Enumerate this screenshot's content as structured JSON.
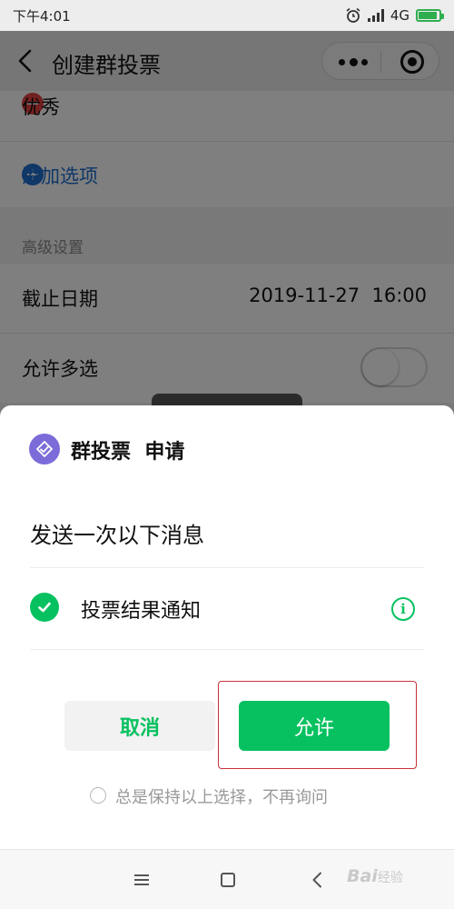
{
  "status_bar": {
    "time": "下午4:01",
    "network": "4G"
  },
  "nav": {
    "title": "创建群投票"
  },
  "form": {
    "option_label": "优秀",
    "add_option_label": "添加选项",
    "section_header": "高级设置",
    "deadline_label": "截止日期",
    "deadline_value": "2019-11-27  16:00",
    "multi_select_label": "允许多选",
    "multi_select_enabled": false
  },
  "dialog": {
    "app_name": "群投票  申请",
    "request_text": "发送一次以下消息",
    "permission_label": "投票结果通知",
    "permission_checked": true,
    "info_glyph": "i",
    "cancel_label": "取消",
    "allow_label": "允许",
    "keep_choice_label": "总是保持以上选择，不再询问"
  },
  "watermark": {
    "brand": "Bai",
    "suffix": "经验"
  },
  "colors": {
    "accent_green": "#07c160",
    "link_blue": "#1f6fd1",
    "remove_red": "#e64340",
    "app_logo_purple": "#7b6cd9",
    "highlight_red": "#c8323a"
  }
}
